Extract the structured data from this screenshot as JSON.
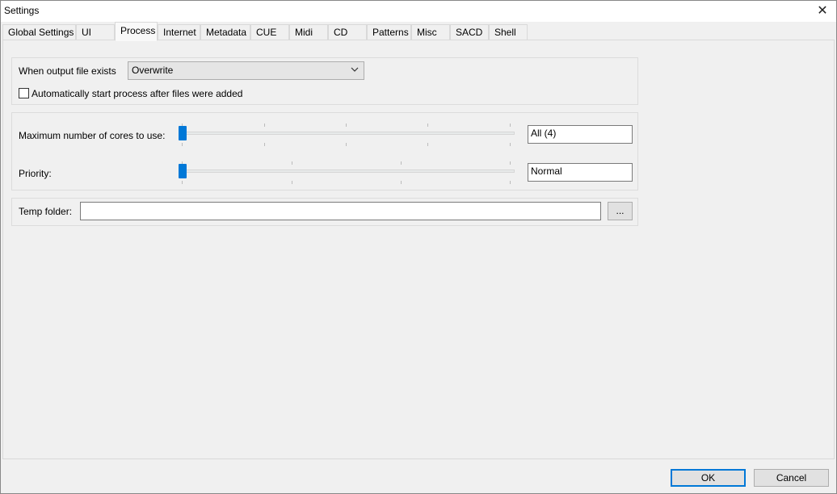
{
  "window": {
    "title": "Settings",
    "close_label": "✕"
  },
  "tabs": [
    {
      "label": "Global Settings"
    },
    {
      "label": "UI"
    },
    {
      "label": "Process",
      "active": true
    },
    {
      "label": "Internet"
    },
    {
      "label": "Metadata"
    },
    {
      "label": "CUE"
    },
    {
      "label": "Midi"
    },
    {
      "label": "CD"
    },
    {
      "label": "Patterns"
    },
    {
      "label": "Misc"
    },
    {
      "label": "SACD"
    },
    {
      "label": "Shell"
    }
  ],
  "process": {
    "output_exists_label": "When output file exists",
    "output_exists_value": "Overwrite",
    "auto_start_label": "Automatically start process after files were added",
    "auto_start_checked": false,
    "max_cores_label": "Maximum number of cores to use:",
    "max_cores_value": "All (4)",
    "max_cores_slider_level": 0,
    "priority_label": "Priority:",
    "priority_value": "Normal",
    "priority_slider_level": 0,
    "temp_folder_label": "Temp folder:",
    "temp_folder_value": "",
    "browse_label": "..."
  },
  "footer": {
    "ok_label": "OK",
    "cancel_label": "Cancel"
  },
  "colors": {
    "accent": "#0078d7",
    "window_bg": "#f0f0f0"
  },
  "icons": {
    "close": "close-icon",
    "dropdown": "chevron-down-icon"
  }
}
